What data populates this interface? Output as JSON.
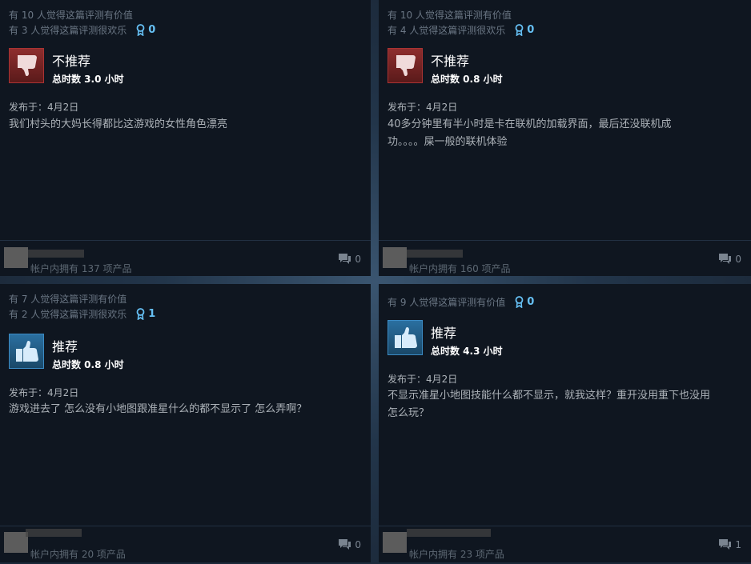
{
  "reviews": [
    {
      "helpful_count": "有 10 人觉得这篇评测有价值",
      "funny_count": "有 3 人觉得这篇评测很欢乐",
      "awards": "0",
      "verdict": "不推荐",
      "recommended": false,
      "hours": "总时数 3.0 小时",
      "posted": "发布于：4月2日",
      "text": "我们村头的大妈长得都比这游戏的女性角色漂亮",
      "products": "帐户内拥有 137 项产品",
      "comments": "0"
    },
    {
      "helpful_count": "有 10 人觉得这篇评测有价值",
      "funny_count": "有 4 人觉得这篇评测很欢乐",
      "awards": "0",
      "verdict": "不推荐",
      "recommended": false,
      "hours": "总时数 0.8 小时",
      "posted": "发布于：4月2日",
      "text_line1": "40多分钟里有半小时是卡在联机的加载界面，最后还没联机成",
      "text_line2": "功。。。。屎一般的联机体验",
      "products": "帐户内拥有 160 项产品",
      "comments": "0"
    },
    {
      "helpful_count": "有 7 人觉得这篇评测有价值",
      "funny_count": "有 2 人觉得这篇评测很欢乐",
      "awards": "1",
      "verdict": "推荐",
      "recommended": true,
      "hours": "总时数 0.8 小时",
      "posted": "发布于：4月2日",
      "text": "游戏进去了 怎么没有小地图跟准星什么的都不显示了 怎么弄啊？",
      "products": "帐户内拥有 20 项产品",
      "comments": "0"
    },
    {
      "helpful_count": "有 9 人觉得这篇评测有价值",
      "awards": "0",
      "verdict": "推荐",
      "recommended": true,
      "hours": "总时数 4.3 小时",
      "posted": "发布于：4月2日",
      "text_line1": "不显示准星小地图技能什么都不显示，就我这样？重开没用重下也没用",
      "text_line2": "怎么玩？",
      "products": "帐户内拥有 23 项产品",
      "comments": "1"
    }
  ],
  "colors": {
    "card_bg": "#0f1620",
    "award": "#66c0f4",
    "thumb_down": "#8e2e2e",
    "thumb_up": "#2a6fa0"
  },
  "icons": [
    "award-icon",
    "thumbs-down-icon",
    "thumbs-up-icon",
    "comment-icon"
  ]
}
